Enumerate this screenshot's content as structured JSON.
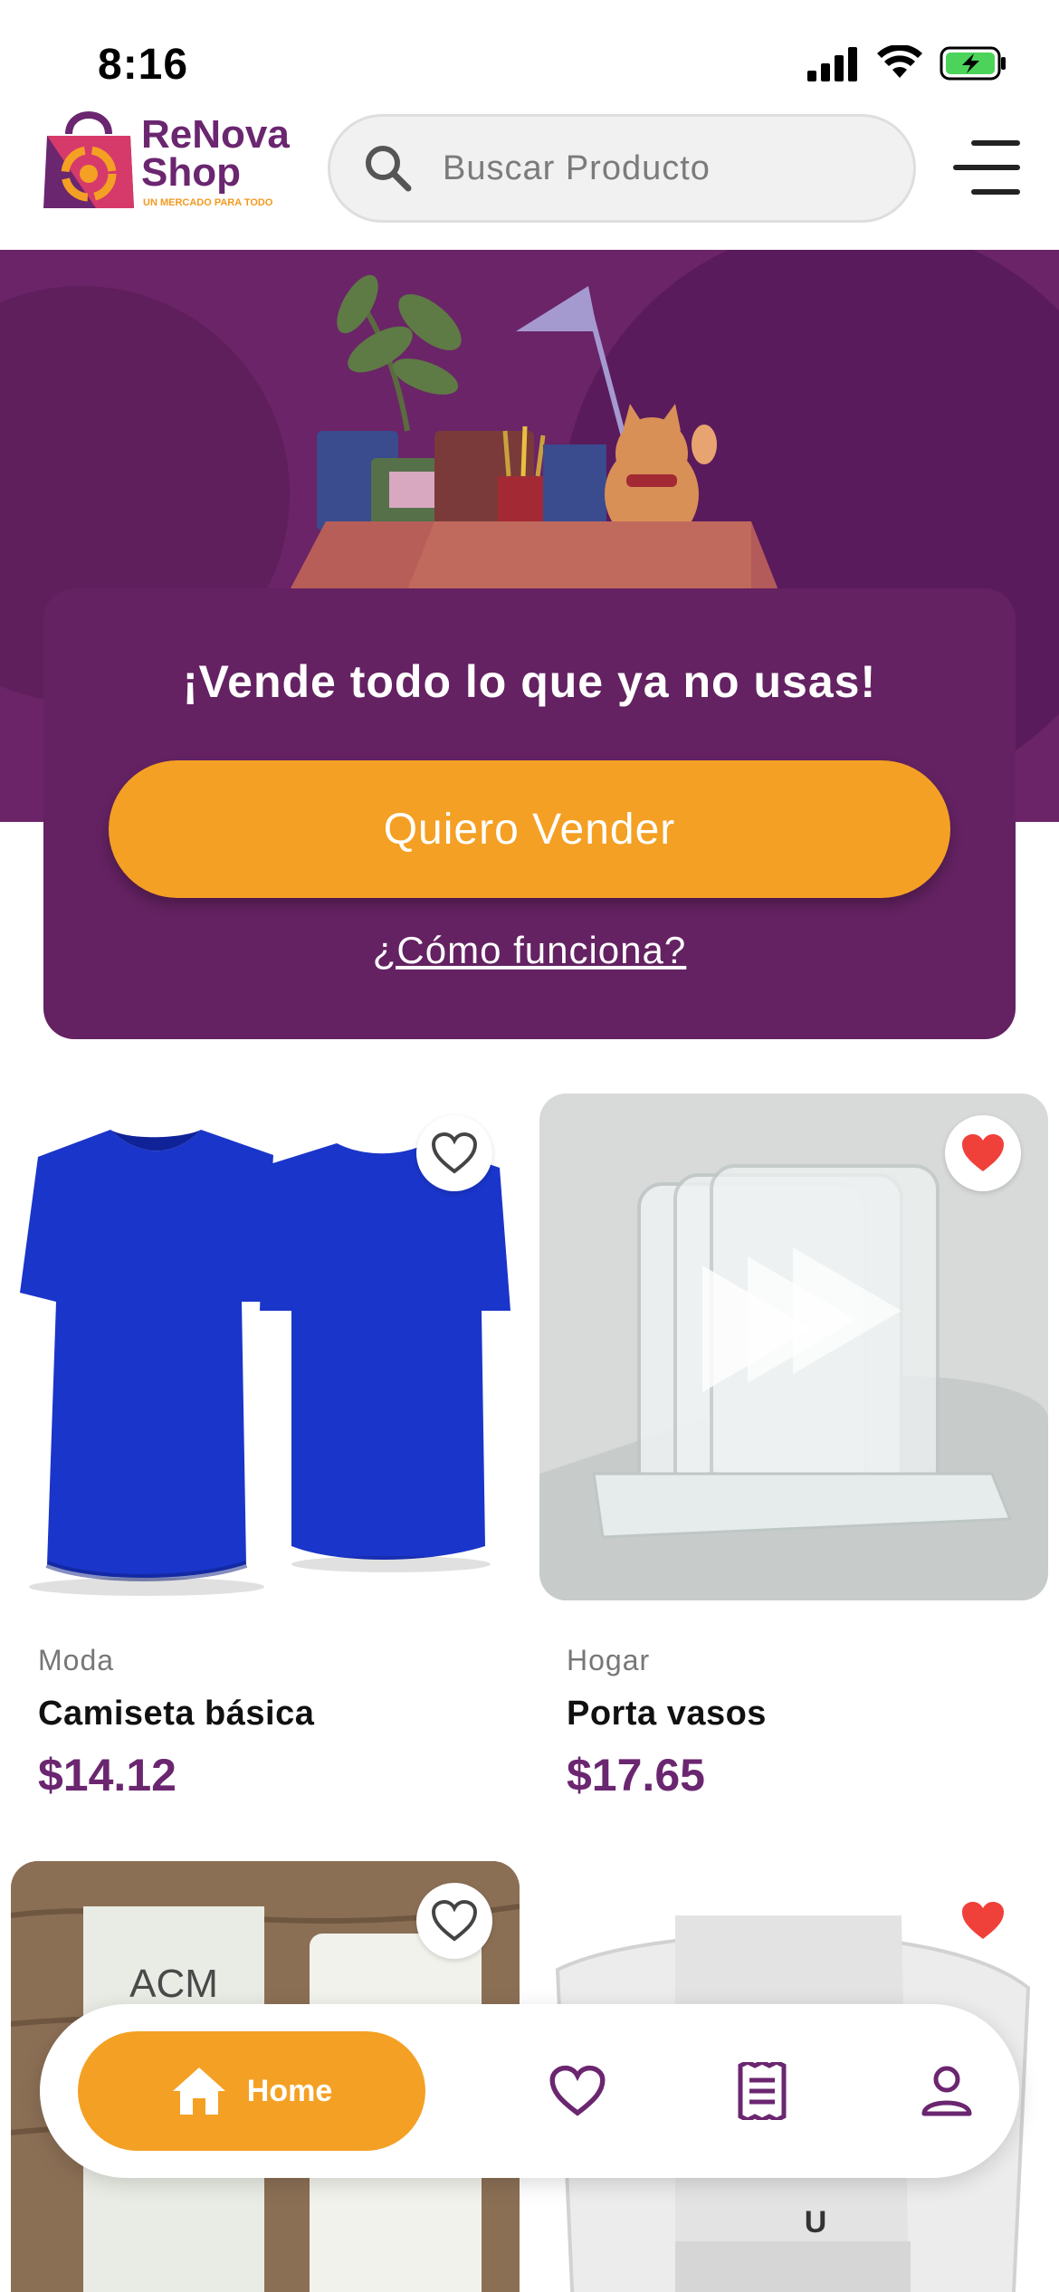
{
  "status_bar": {
    "time": "8:16"
  },
  "header": {
    "logo_line1": "ReNova",
    "logo_line2": "Shop",
    "logo_tagline": "UN MERCADO PARA TODO",
    "search_placeholder": "Buscar Producto"
  },
  "promo": {
    "title": "¡Vende todo lo que ya no usas!",
    "cta": "Quiero Vender",
    "link": "¿Cómo funciona?"
  },
  "products": [
    {
      "category": "Moda",
      "name": "Camiseta básica",
      "price": "$14.12",
      "favorited": false
    },
    {
      "category": "Hogar",
      "name": "Porta vasos",
      "price": "$17.65",
      "favorited": true
    },
    {
      "favorited": false
    },
    {
      "favorited": true
    }
  ],
  "bottom_nav": {
    "home_label": "Home"
  },
  "colors": {
    "brand_purple": "#6b2670",
    "accent_orange": "#f4a024",
    "heart_red": "#f0403a"
  }
}
